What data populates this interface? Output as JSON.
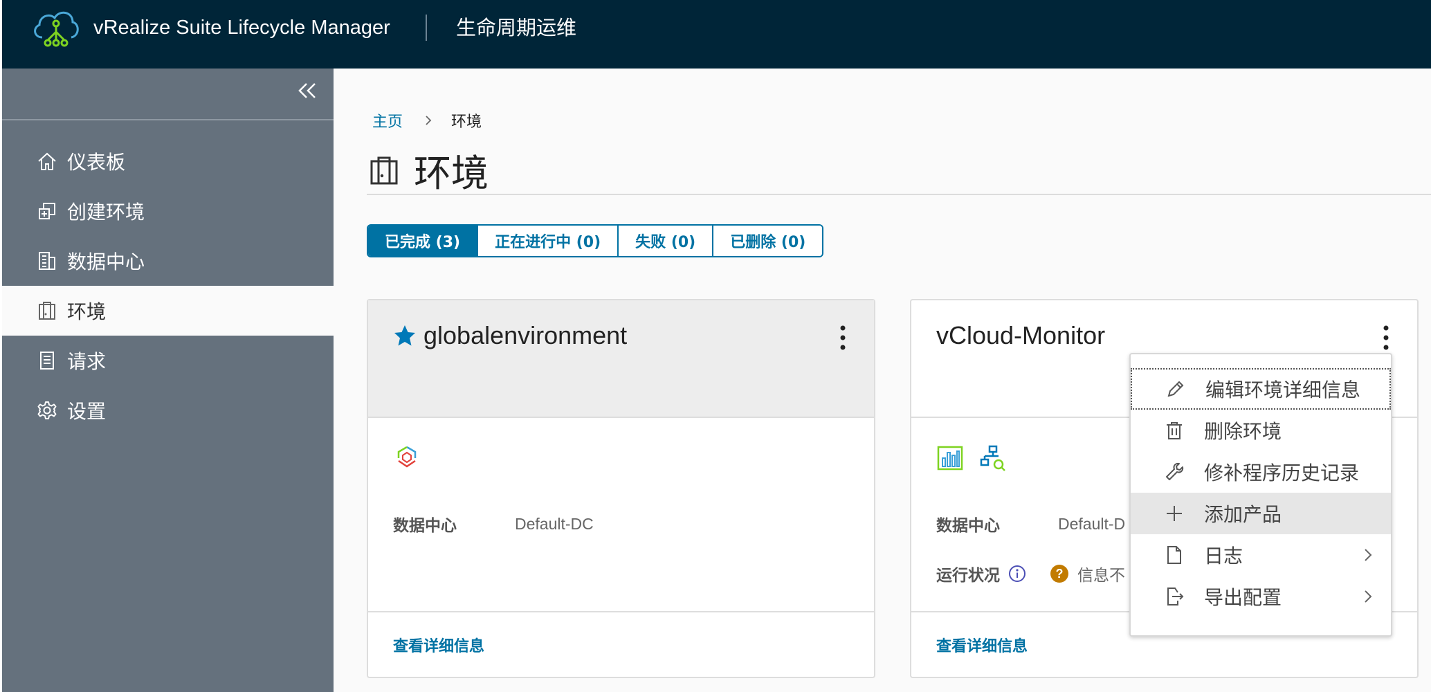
{
  "header": {
    "app_title": "vRealize Suite Lifecycle Manager",
    "module_title": "生命周期运维"
  },
  "sidebar": {
    "items": [
      {
        "label": "仪表板",
        "icon": "home-icon"
      },
      {
        "label": "创建环境",
        "icon": "create-environment-icon"
      },
      {
        "label": "数据中心",
        "icon": "datacenter-icon"
      },
      {
        "label": "环境",
        "icon": "environment-icon",
        "active": true
      },
      {
        "label": "请求",
        "icon": "requests-icon"
      },
      {
        "label": "设置",
        "icon": "gear-icon"
      }
    ]
  },
  "breadcrumb": {
    "home": "主页",
    "current": "环境"
  },
  "page": {
    "title": "环境"
  },
  "tabs": [
    {
      "label": "已完成 (3)",
      "active": true
    },
    {
      "label": "正在进行中 (0)"
    },
    {
      "label": "失败 (0)"
    },
    {
      "label": "已删除 (0)"
    }
  ],
  "cards": [
    {
      "name": "globalenvironment",
      "favorite": true,
      "datacenter_key": "数据中心",
      "datacenter_value": "Default-DC",
      "details_link": "查看详细信息"
    },
    {
      "name": "vCloud-Monitor",
      "datacenter_key": "数据中心",
      "datacenter_value": "Default-D",
      "health_key": "运行状况",
      "health_value": "信息不",
      "details_link": "查看详细信息"
    }
  ],
  "menu": {
    "items": [
      {
        "label": "编辑环境详细信息",
        "icon": "pencil-icon"
      },
      {
        "label": "删除环境",
        "icon": "trash-icon"
      },
      {
        "label": "修补程序历史记录",
        "icon": "wrench-icon"
      },
      {
        "label": "添加产品",
        "icon": "plus-icon"
      },
      {
        "label": "日志",
        "icon": "file-icon",
        "submenu": true
      },
      {
        "label": "导出配置",
        "icon": "export-icon",
        "submenu": true
      }
    ]
  },
  "colors": {
    "header_bg": "#002538",
    "sidebar_bg": "#65717d",
    "accent": "#0072a3",
    "favorite_star": "#0079b8",
    "health_unknown": "#c27b00"
  }
}
